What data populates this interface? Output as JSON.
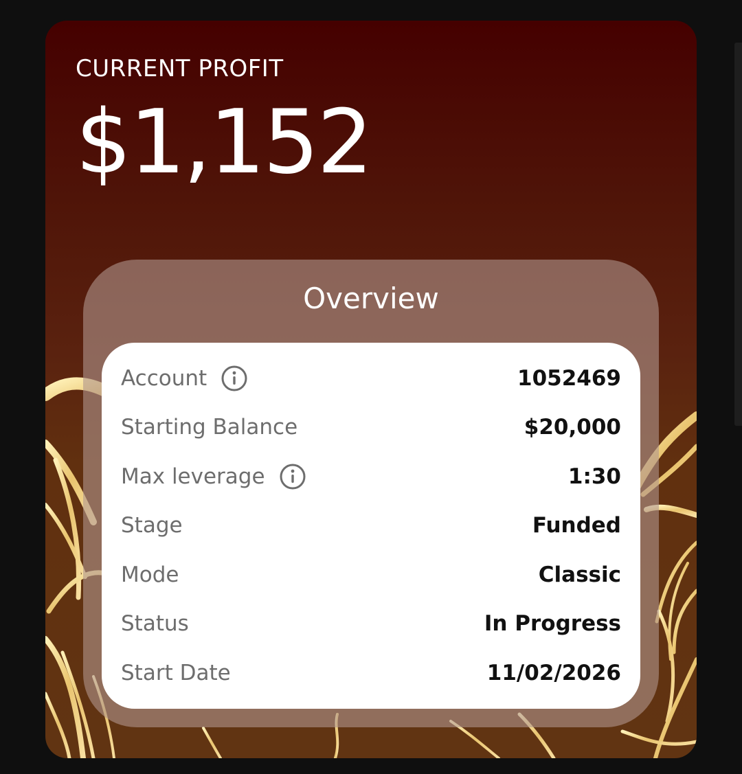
{
  "card": {
    "profit_label": "CURRENT PROFIT",
    "profit_value": "$1,152"
  },
  "overview": {
    "title": "Overview",
    "rows": [
      {
        "label": "Account",
        "value": "1052469",
        "icon": "info-icon"
      },
      {
        "label": "Starting Balance",
        "value": "$20,000"
      },
      {
        "label": "Max leverage",
        "value": "1:30",
        "icon": "info-icon"
      },
      {
        "label": "Stage",
        "value": "Funded"
      },
      {
        "label": "Mode",
        "value": "Classic"
      },
      {
        "label": "Status",
        "value": "In Progress"
      },
      {
        "label": "Start Date",
        "value": "11/02/2026"
      }
    ]
  },
  "colors": {
    "page_background": "#0f0f0f",
    "card_top": "#450000",
    "card_bottom": "#613412",
    "ornament_gold": "#f1d58d",
    "panel_background": "#b0968e",
    "label_grey": "#6d6d6d",
    "value_black": "#111111"
  }
}
